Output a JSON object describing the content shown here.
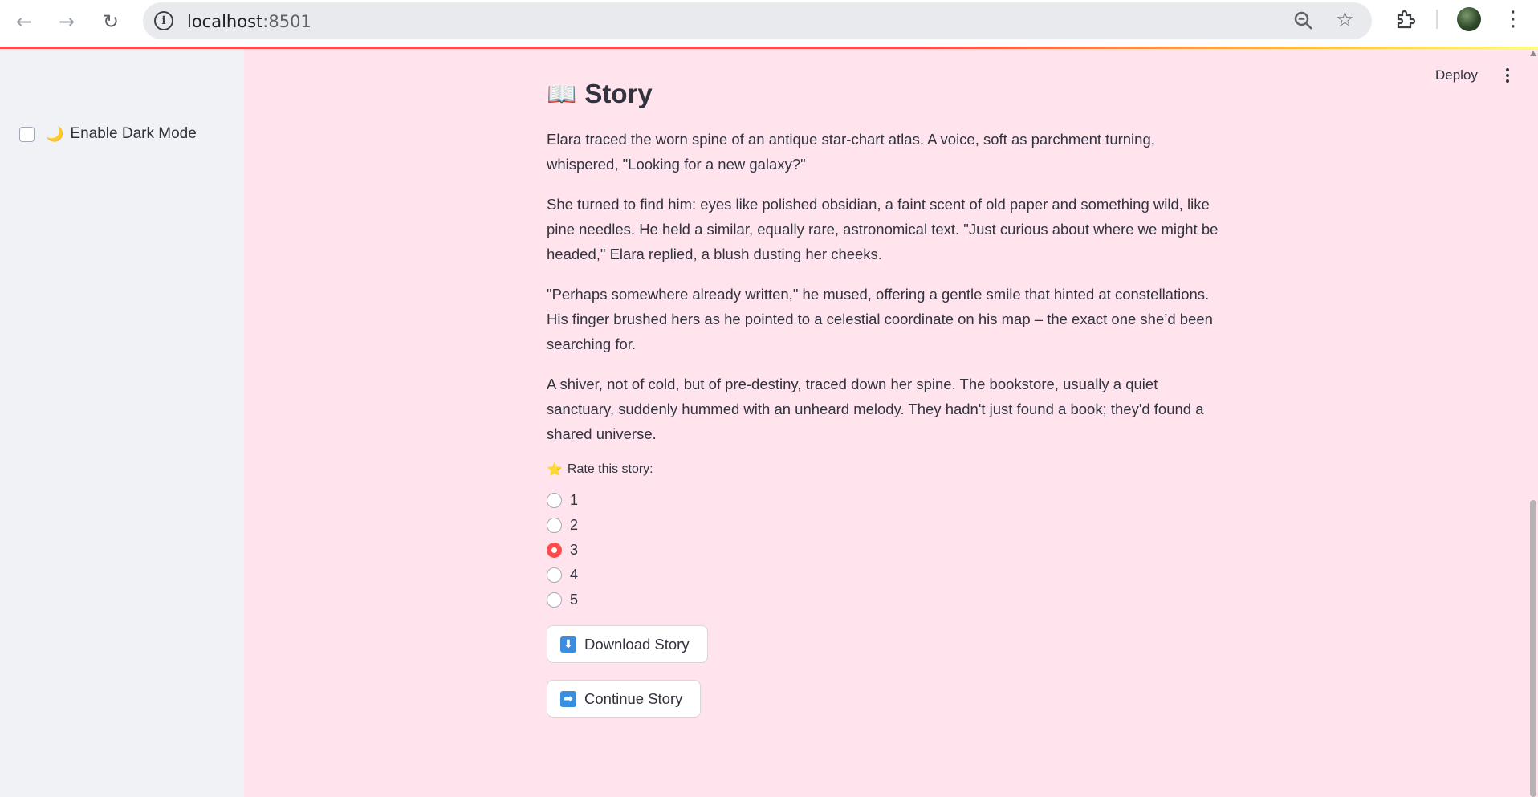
{
  "browser": {
    "url_host": "localhost",
    "url_port": ":8501"
  },
  "sidebar": {
    "dark_mode_emoji": "🌙",
    "dark_mode_label": "Enable Dark Mode"
  },
  "toolbar": {
    "deploy_label": "Deploy"
  },
  "main": {
    "title_emoji": "📖",
    "title": "Story",
    "paragraphs": [
      "Elara traced the worn spine of an antique star-chart atlas. A voice, soft as parchment turning, whispered, \"Looking for a new galaxy?\"",
      "She turned to find him: eyes like polished obsidian, a faint scent of old paper and something wild, like pine needles. He held a similar, equally rare, astronomical text. \"Just curious about where we might be headed,\" Elara replied, a blush dusting her cheeks.",
      "\"Perhaps somewhere already written,\" he mused, offering a gentle smile that hinted at constellations. His finger brushed hers as he pointed to a celestial coordinate on his map – the exact one she’d been searching for.",
      "A shiver, not of cold, but of pre-destiny, traced down her spine. The bookstore, usually a quiet sanctuary, suddenly hummed with an unheard melody. They hadn't just found a book; they'd found a shared universe."
    ],
    "rating": {
      "emoji": "⭐",
      "label": "Rate this story:",
      "options": [
        "1",
        "2",
        "3",
        "4",
        "5"
      ],
      "selected": "3"
    },
    "download_icon": "⬇",
    "download_label": "Download Story",
    "continue_icon": "➡",
    "continue_label": "Continue Story"
  },
  "colors": {
    "background": "#ffe4ee",
    "sidebar": "#f0f2f6",
    "accent": "#ff4b4b",
    "text": "#31333f"
  }
}
